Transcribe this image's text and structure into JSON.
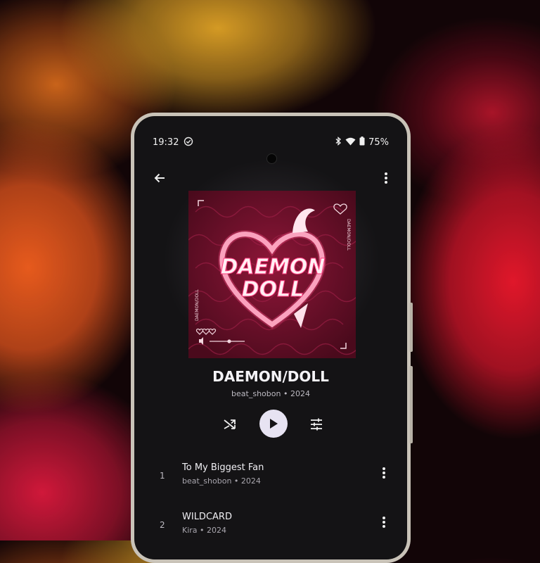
{
  "status_bar": {
    "time": "19:32",
    "battery": "75%",
    "icons": [
      "check-circle-icon",
      "bluetooth-icon",
      "wifi-icon",
      "battery-icon"
    ]
  },
  "toolbar": {
    "back_icon": "arrow-left-icon",
    "more_icon": "more-vertical-icon"
  },
  "album": {
    "title": "DAEMON/DOLL",
    "subtitle": "beat_shobon • 2024",
    "cover_text": "DAEMON DOLL",
    "cover_side_text": "DAEMON/DOLL",
    "cover_side_text_left": "DAEMON/DOLL",
    "colors": {
      "cover_bg": "#5c0f24",
      "cover_pattern": "#8a1a3c",
      "cover_glow": "#ff3d7f"
    }
  },
  "controls": {
    "shuffle_icon": "shuffle-icon",
    "play_icon": "play-icon",
    "equalizer_icon": "tune-icon"
  },
  "tracks": [
    {
      "number": "1",
      "title": "To My Biggest Fan",
      "subtitle": "beat_shobon • 2024"
    },
    {
      "number": "2",
      "title": "WILDCARD",
      "subtitle": "Kira • 2024"
    }
  ],
  "theme": {
    "screen_bg": "#141315",
    "play_button_bg": "#e7e3f2",
    "frame_color": "#c9c3b8"
  }
}
